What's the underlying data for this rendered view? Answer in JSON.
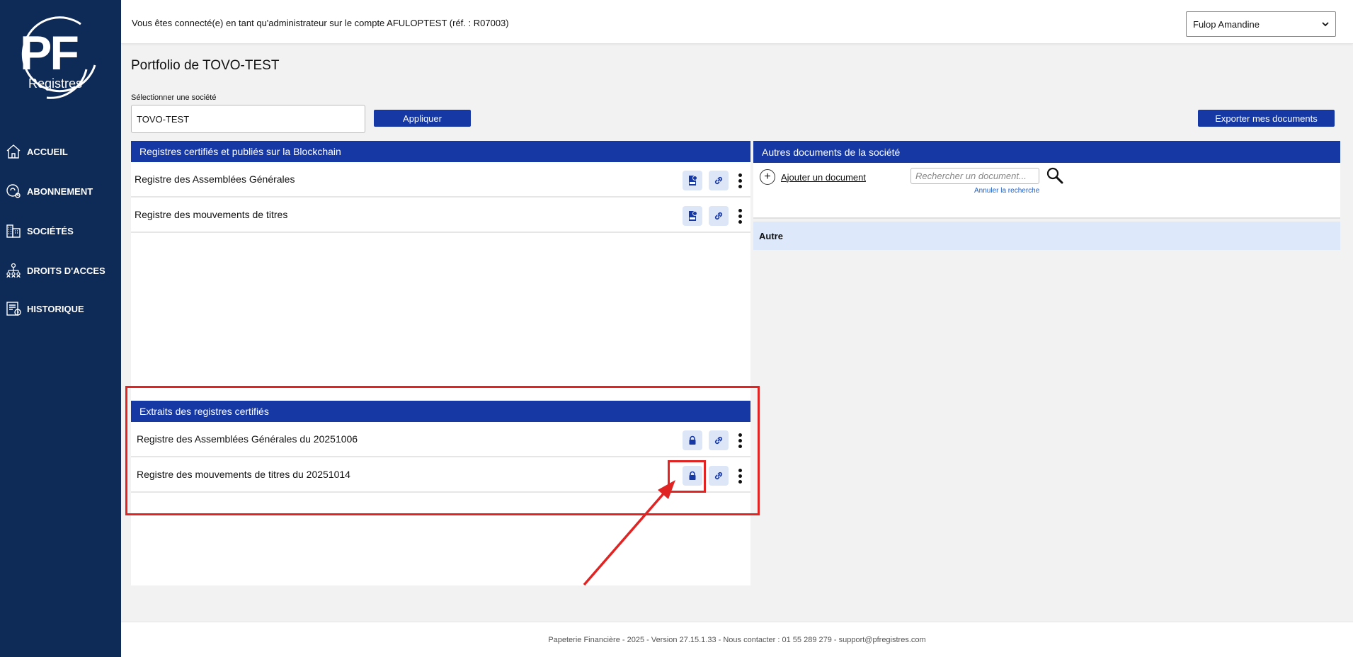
{
  "sidebar": {
    "logo_text": "PF",
    "logo_sub": "Registres",
    "items": [
      {
        "label": "ACCUEIL",
        "icon": "home-icon"
      },
      {
        "label": "ABONNEMENT",
        "icon": "subscription-icon"
      },
      {
        "label": "SOCIÉTÉS",
        "icon": "buildings-icon"
      },
      {
        "label": "DROITS D'ACCES",
        "icon": "access-rights-icon"
      },
      {
        "label": "HISTORIQUE",
        "icon": "history-icon"
      }
    ]
  },
  "header": {
    "connection_message": "Vous êtes connecté(e) en tant qu'administrateur sur le compte AFULOPTEST (réf. : R07003)",
    "user_selected": "Fulop Amandine"
  },
  "page": {
    "title": "Portfolio de TOVO-TEST",
    "select_label": "Sélectionner une société",
    "company_value": "TOVO-TEST",
    "apply_label": "Appliquer",
    "export_label": "Exporter mes documents"
  },
  "registres": {
    "header": "Registres certifiés et publiés sur la Blockchain",
    "items": [
      {
        "name": "Registre des Assemblées Générales"
      },
      {
        "name": "Registre des mouvements de titres"
      }
    ]
  },
  "extraits": {
    "header": "Extraits des registres certifiés",
    "items": [
      {
        "name": "Registre des Assemblées Générales du 20251006"
      },
      {
        "name": "Registre des mouvements de titres du 20251014"
      }
    ]
  },
  "autres": {
    "header": "Autres documents de la société",
    "add_label": "Ajouter un document",
    "search_placeholder": "Rechercher un document...",
    "cancel_search": "Annuler la recherche",
    "category": "Autre"
  },
  "footer": {
    "text": "Papeterie Financière - 2025 - Version 27.15.1.33 - Nous contacter : 01 55 289 279 - support@pfregistres.com"
  },
  "colors": {
    "sidebar": "#0e2a57",
    "accent": "#1638a5",
    "action_bg": "#dce6f7",
    "annotation": "#e02424"
  }
}
